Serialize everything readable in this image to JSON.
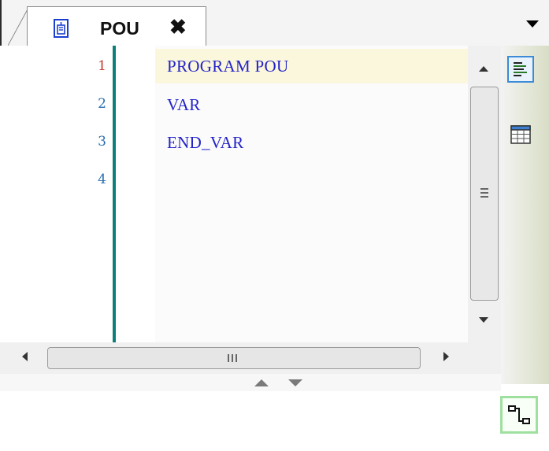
{
  "tab": {
    "title": "POU",
    "close_glyph": "✖",
    "icon": "pou-document-icon"
  },
  "tabstrip": {
    "dropdown_icon": "chevron-down-icon"
  },
  "editor": {
    "line_numbers": [
      "1",
      "2",
      "3",
      "4"
    ],
    "current_line": 1,
    "lines": [
      "PROGRAM POU",
      "VAR",
      "END_VAR",
      ""
    ]
  },
  "sidebar": {
    "views": [
      {
        "name": "textual-view-icon",
        "selected": true
      },
      {
        "name": "tabular-view-icon",
        "selected": false
      }
    ]
  },
  "bottom": {
    "network_button_icon": "network-connection-icon"
  },
  "colors": {
    "keyword": "#2323c8",
    "line_number": "#2a6fb0",
    "current_line_number": "#c0392b",
    "gutter_bar": "#0d7f7a",
    "current_line_bg": "#fbf7dd",
    "selected_view_border": "#3c8ad8",
    "network_button_border": "#9fe09f"
  }
}
